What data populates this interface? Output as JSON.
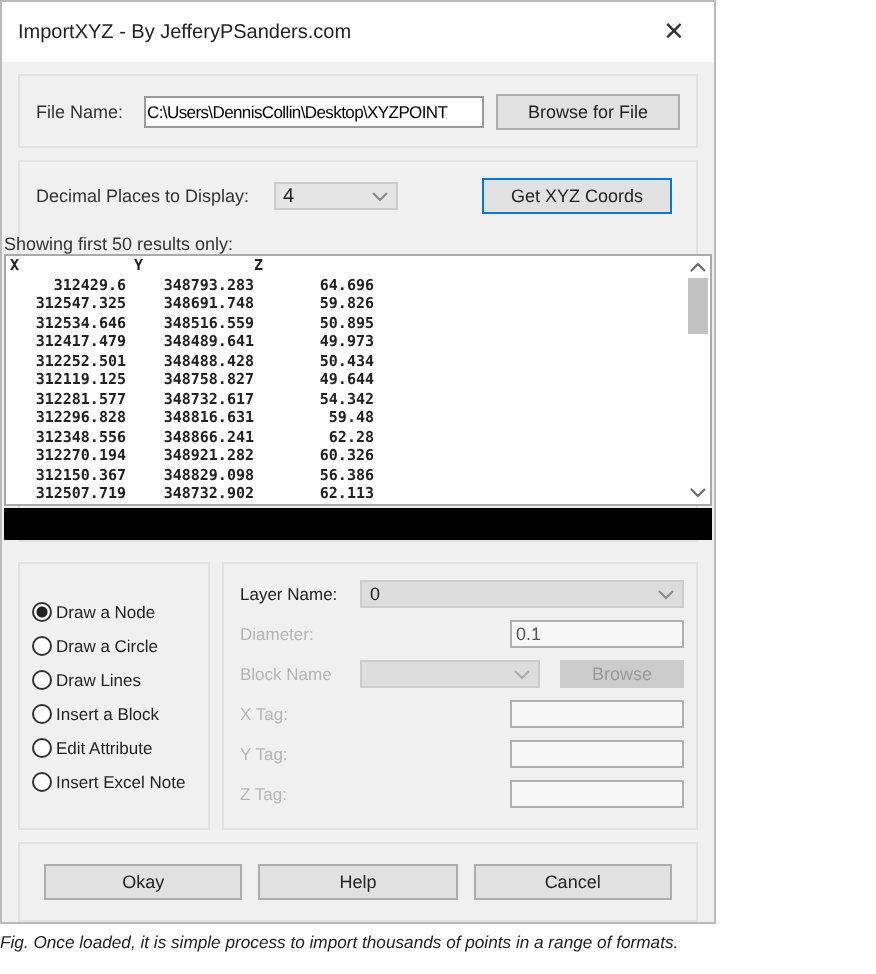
{
  "window": {
    "title": "ImportXYZ - By JefferyPSanders.com",
    "close": "×"
  },
  "file": {
    "label": "File Name:",
    "value": "C:\\Users\\DennisCollin\\Desktop\\XYZPOINT",
    "button": "Browse for File"
  },
  "decimal": {
    "label": "Decimal Places to Display:",
    "value": "4",
    "button": "Get XYZ Coords"
  },
  "results": {
    "caption": "Showing first 50 results only:",
    "columns": [
      "X",
      "Y",
      "Z"
    ],
    "rows": [
      [
        "312429.6",
        "348793.283",
        "64.696"
      ],
      [
        "312547.325",
        "348691.748",
        "59.826"
      ],
      [
        "312534.646",
        "348516.559",
        "50.895"
      ],
      [
        "312417.479",
        "348489.641",
        "49.973"
      ],
      [
        "312252.501",
        "348488.428",
        "50.434"
      ],
      [
        "312119.125",
        "348758.827",
        "49.644"
      ],
      [
        "312281.577",
        "348732.617",
        "54.342"
      ],
      [
        "312296.828",
        "348816.631",
        "59.48"
      ],
      [
        "312348.556",
        "348866.241",
        "62.28"
      ],
      [
        "312270.194",
        "348921.282",
        "60.326"
      ],
      [
        "312150.367",
        "348829.098",
        "56.386"
      ],
      [
        "312507.719",
        "348732.902",
        "62.113"
      ]
    ]
  },
  "options": [
    {
      "label": "Draw a Node",
      "selected": true
    },
    {
      "label": "Draw a Circle",
      "selected": false
    },
    {
      "label": "Draw Lines",
      "selected": false
    },
    {
      "label": "Insert a Block",
      "selected": false
    },
    {
      "label": "Edit Attribute",
      "selected": false
    },
    {
      "label": "Insert Excel Note",
      "selected": false
    }
  ],
  "settings": [
    {
      "kind": "select",
      "label": "Layer Name:",
      "value": "0",
      "disabled": false
    },
    {
      "kind": "field",
      "label": "Diameter:",
      "value": "0.1",
      "disabled": true
    },
    {
      "kind": "select-button",
      "label": "Block Name",
      "button": "Browse",
      "disabled": true
    },
    {
      "kind": "field",
      "label": "X Tag:",
      "disabled": true
    },
    {
      "kind": "field",
      "label": "Y Tag:",
      "disabled": true
    },
    {
      "kind": "field",
      "label": "Z Tag:",
      "disabled": true
    }
  ],
  "buttons": [
    "Okay",
    "Help",
    "Cancel"
  ],
  "caption": "Fig. Once loaded, it is simple process to import thousands of points in a range of formats."
}
